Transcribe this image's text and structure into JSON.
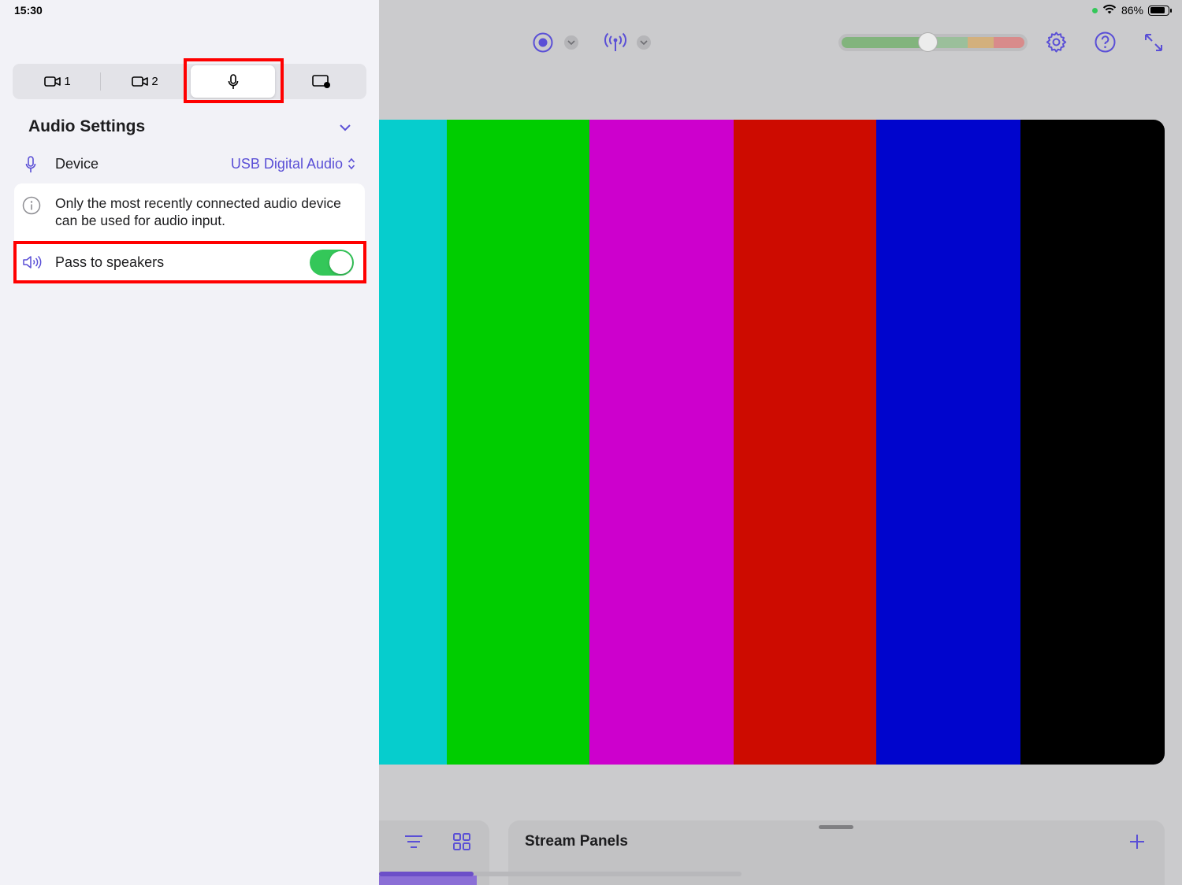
{
  "status_bar": {
    "time": "15:30",
    "battery_percent": "86%",
    "battery_level": 0.86
  },
  "sidebar": {
    "tabs": [
      {
        "label": "1",
        "icon": "video-camera-icon"
      },
      {
        "label": "2",
        "icon": "video-camera-icon"
      },
      {
        "label": "",
        "icon": "microphone-icon",
        "selected": true
      },
      {
        "label": "",
        "icon": "screen-overlay-icon"
      }
    ],
    "section_title": "Audio Settings",
    "device": {
      "label": "Device",
      "value": "USB Digital Audio"
    },
    "info_text": "Only the most recently connected audio device can be used for audio input.",
    "pass_to_speakers": {
      "label": "Pass to speakers",
      "enabled": true
    }
  },
  "toolbar": {
    "icons": [
      "record-icon",
      "broadcast-icon",
      "settings-gear-icon",
      "help-icon",
      "expand-icon"
    ],
    "audio_level_position": 0.47
  },
  "preview": {
    "color_bars": [
      "#06cdcd",
      "#00cd00",
      "#cd00cd",
      "#cd0b00",
      "#0005cd",
      "#000000"
    ]
  },
  "stream_panels": {
    "title": "Stream Panels"
  },
  "colors": {
    "accent": "#5a4fd6",
    "toggle_on": "#34c759",
    "highlight": "#ff0000"
  }
}
